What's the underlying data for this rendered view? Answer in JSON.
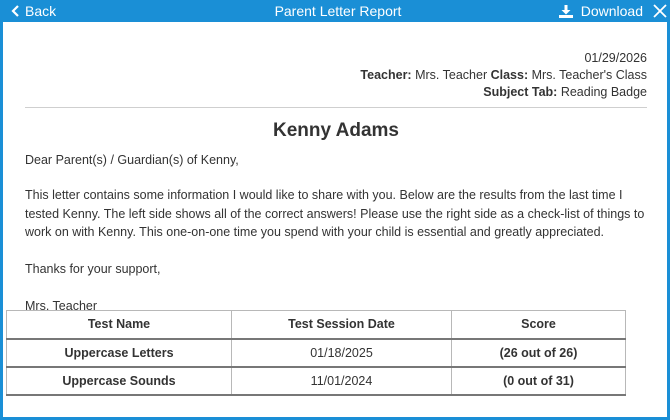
{
  "header": {
    "back_label": "Back",
    "title": "Parent Letter Report",
    "download_label": "Download"
  },
  "meta": {
    "date": "01/29/2026",
    "teacher_label": "Teacher:",
    "teacher": "Mrs. Teacher",
    "class_label": "Class:",
    "class": "Mrs. Teacher's Class",
    "subject_label": "Subject Tab:",
    "subject": "Reading Badge"
  },
  "student_name": "Kenny Adams",
  "letter": {
    "greeting": "Dear Parent(s) / Guardian(s) of Kenny,",
    "body": "This letter contains some information I would like to share with you. Below are the results from the last time I tested Kenny. The left side shows all of the correct answers! Please use the right side as a check-list of things to work on with Kenny. This one-on-one time you spend with your child is essential and greatly appreciated.",
    "thanks": "Thanks for your support,",
    "signature": "Mrs. Teacher"
  },
  "table": {
    "headers": [
      "Test Name",
      "Test Session Date",
      "Score"
    ],
    "rows": [
      {
        "name": "Uppercase Letters",
        "date": "01/18/2025",
        "score": "(26 out of 26)"
      },
      {
        "name": "Uppercase Sounds",
        "date": "11/01/2024",
        "score": "(0 out of 31)"
      }
    ]
  },
  "colors": {
    "accent": "#1a8fd6"
  }
}
